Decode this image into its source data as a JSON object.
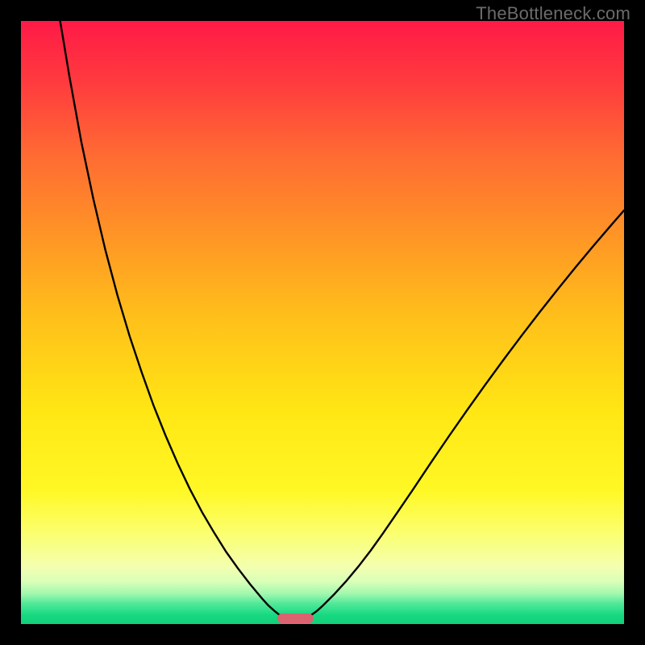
{
  "watermark": {
    "text": "TheBottleneck.com"
  },
  "chart_data": {
    "type": "line",
    "title": "",
    "xlabel": "",
    "ylabel": "",
    "xlim": [
      0,
      100
    ],
    "ylim": [
      0,
      100
    ],
    "series": [
      {
        "name": "curve-left",
        "x": [
          6.5,
          8,
          10,
          12,
          14,
          16,
          18,
          20,
          22,
          24,
          26,
          28,
          30,
          32,
          34,
          36,
          38,
          40,
          41,
          42,
          43
        ],
        "y": [
          100,
          91,
          80,
          70.5,
          62,
          54.5,
          47.8,
          41.8,
          36.2,
          31.2,
          26.6,
          22.4,
          18.6,
          15.2,
          12.0,
          9.2,
          6.6,
          4.2,
          3.1,
          2.2,
          1.4
        ]
      },
      {
        "name": "curve-right",
        "x": [
          48,
          49,
          50,
          52,
          54,
          56,
          58,
          60,
          62,
          65,
          68,
          71,
          74,
          77,
          80,
          83,
          86,
          89,
          92,
          95,
          98,
          100
        ],
        "y": [
          1.4,
          2.1,
          3.0,
          5.0,
          7.2,
          9.6,
          12.2,
          15.0,
          17.9,
          22.3,
          26.8,
          31.2,
          35.5,
          39.7,
          43.8,
          47.8,
          51.7,
          55.5,
          59.2,
          62.8,
          66.3,
          68.6
        ]
      }
    ],
    "marker": {
      "name": "bottleneck-marker",
      "x_center": 45.5,
      "width_pct": 6.0,
      "color": "#d9636e"
    },
    "background": {
      "stops": [
        {
          "t": 0.0,
          "color": "#ff1a47"
        },
        {
          "t": 0.1,
          "color": "#ff3a3e"
        },
        {
          "t": 0.22,
          "color": "#ff6a33"
        },
        {
          "t": 0.35,
          "color": "#ff9326"
        },
        {
          "t": 0.5,
          "color": "#ffc21a"
        },
        {
          "t": 0.65,
          "color": "#ffe714"
        },
        {
          "t": 0.78,
          "color": "#fff826"
        },
        {
          "t": 0.85,
          "color": "#fbff70"
        },
        {
          "t": 0.905,
          "color": "#f4ffb0"
        },
        {
          "t": 0.93,
          "color": "#d9ffb8"
        },
        {
          "t": 0.95,
          "color": "#a0f8ae"
        },
        {
          "t": 0.965,
          "color": "#56e99a"
        },
        {
          "t": 0.985,
          "color": "#17d981"
        },
        {
          "t": 1.0,
          "color": "#13cf7a"
        }
      ]
    }
  }
}
